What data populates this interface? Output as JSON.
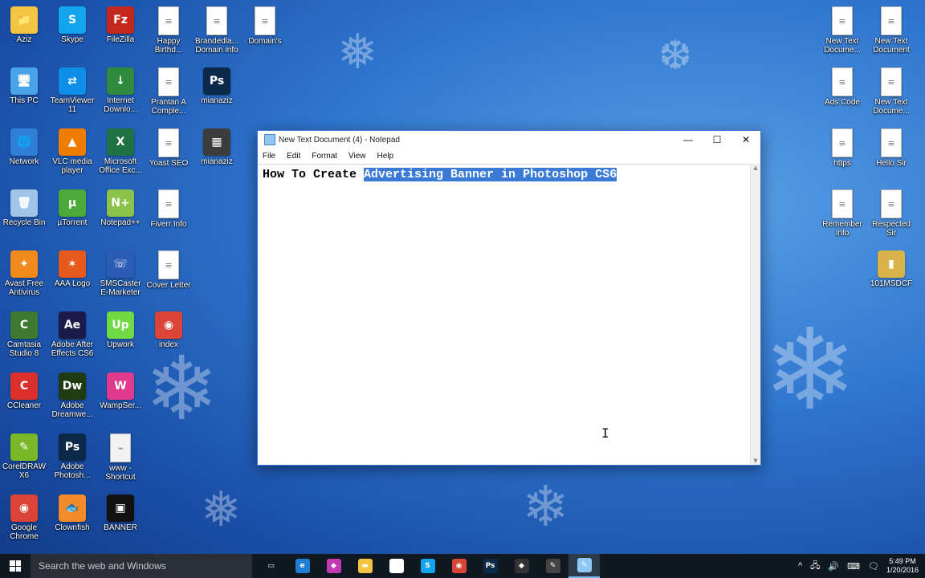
{
  "desktop": {
    "icons": [
      {
        "label": "Aziz",
        "icon": "folder-user-icon",
        "color": "#f4c542",
        "glyph": "📁"
      },
      {
        "label": "Skype",
        "icon": "skype-icon",
        "color": "#12a5ee",
        "glyph": "S"
      },
      {
        "label": "FileZilla",
        "icon": "filezilla-icon",
        "color": "#c4271b",
        "glyph": "Fz"
      },
      {
        "label": "Happy\nBirthd...",
        "icon": "text-document-icon",
        "color": "#ffffff",
        "glyph": "≡"
      },
      {
        "label": "Brandedla...\nDomain info",
        "icon": "text-document-icon",
        "color": "#ffffff",
        "glyph": "≡"
      },
      {
        "label": "Domain's",
        "icon": "text-document-icon",
        "color": "#ffffff",
        "glyph": "≡"
      },
      {
        "label": "This PC",
        "icon": "computer-icon",
        "color": "#4aa3e8",
        "glyph": "🖥"
      },
      {
        "label": "TeamViewer\n11",
        "icon": "teamviewer-icon",
        "color": "#0e8ee9",
        "glyph": "⇄"
      },
      {
        "label": "Internet\nDownlo...",
        "icon": "internet-download-manager-icon",
        "color": "#2e8b3e",
        "glyph": "↓"
      },
      {
        "label": "Prantan A\nComple...",
        "icon": "wordpad-document-icon",
        "color": "#ffffff",
        "glyph": "≡"
      },
      {
        "label": "mianaziz",
        "icon": "photoshop-file-icon",
        "color": "#0b2a4a",
        "glyph": "Ps"
      },
      {
        "label": "Network",
        "icon": "network-icon",
        "color": "#2f7fd6",
        "glyph": "🌐"
      },
      {
        "label": "VLC media\nplayer",
        "icon": "vlc-icon",
        "color": "#f07c00",
        "glyph": "▲"
      },
      {
        "label": "Microsoft\nOffice Exc...",
        "icon": "excel-icon",
        "color": "#1f7244",
        "glyph": "X"
      },
      {
        "label": "Yoast SEO",
        "icon": "wordpad-document-icon",
        "color": "#ffffff",
        "glyph": "≡"
      },
      {
        "label": "mianaziz",
        "icon": "image-file-icon",
        "color": "#3c3c3c",
        "glyph": "▦"
      },
      {
        "label": "Recycle Bin",
        "icon": "recycle-bin-icon",
        "color": "#9fc6e8",
        "glyph": "🗑"
      },
      {
        "label": "µTorrent",
        "icon": "utorrent-icon",
        "color": "#4caa3a",
        "glyph": "µ"
      },
      {
        "label": "Notepad++",
        "icon": "notepadplusplus-icon",
        "color": "#8bc34a",
        "glyph": "N+"
      },
      {
        "label": "Fiverr Info",
        "icon": "wordpad-document-icon",
        "color": "#ffffff",
        "glyph": "≡"
      },
      {
        "label": "Avast Free\nAntivirus",
        "icon": "avast-icon",
        "color": "#f08a1c",
        "glyph": "✦"
      },
      {
        "label": "AAA Logo",
        "icon": "aaa-logo-icon",
        "color": "#e55a1c",
        "glyph": "✶"
      },
      {
        "label": "SMSCaster\nE-Marketer",
        "icon": "phone-icon",
        "color": "#2a5bb5",
        "glyph": "☏"
      },
      {
        "label": "Cover Letter",
        "icon": "wordpad-document-icon",
        "color": "#ffffff",
        "glyph": "≡"
      },
      {
        "label": "Camtasia\nStudio 8",
        "icon": "camtasia-icon",
        "color": "#3d7a2f",
        "glyph": "C"
      },
      {
        "label": "Adobe After\nEffects CS6",
        "icon": "after-effects-icon",
        "color": "#1b1a4a",
        "glyph": "Ae"
      },
      {
        "label": "Upwork",
        "icon": "upwork-icon",
        "color": "#6fda44",
        "glyph": "Up"
      },
      {
        "label": "index",
        "icon": "chrome-html-icon",
        "color": "#db4437",
        "glyph": "◉"
      },
      {
        "label": "CCleaner",
        "icon": "ccleaner-icon",
        "color": "#d9302b",
        "glyph": "C"
      },
      {
        "label": "Adobe\nDreamwe...",
        "icon": "dreamweaver-icon",
        "color": "#1e3b12",
        "glyph": "Dw"
      },
      {
        "label": "WampSer...",
        "icon": "wampserver-icon",
        "color": "#e0398e",
        "glyph": "W"
      },
      {
        "label": "CorelDRAW\nX6",
        "icon": "coreldraw-icon",
        "color": "#79b829",
        "glyph": "✎"
      },
      {
        "label": "Adobe\nPhotosh...",
        "icon": "photoshop-icon",
        "color": "#0b2a4a",
        "glyph": "Ps"
      },
      {
        "label": "www -\nShortcut",
        "icon": "shortcut-file-icon",
        "color": "#f2f2f2",
        "glyph": "⌁"
      },
      {
        "label": "Google\nChrome",
        "icon": "chrome-icon",
        "color": "#db4437",
        "glyph": "◉"
      },
      {
        "label": "Clownfish",
        "icon": "clownfish-icon",
        "color": "#f28c28",
        "glyph": "🐟"
      },
      {
        "label": "BANNER",
        "icon": "image-file-icon",
        "color": "#111111",
        "glyph": "▣"
      },
      {
        "label": "New Text\nDocume...",
        "icon": "text-document-icon",
        "color": "#ffffff",
        "glyph": "≡"
      },
      {
        "label": "New Text\nDocument",
        "icon": "text-document-icon",
        "color": "#ffffff",
        "glyph": "≡"
      },
      {
        "label": "Ads Code",
        "icon": "text-document-icon",
        "color": "#ffffff",
        "glyph": "≡"
      },
      {
        "label": "New Text\nDocume...",
        "icon": "text-document-icon",
        "color": "#ffffff",
        "glyph": "≡"
      },
      {
        "label": "https",
        "icon": "wordpad-document-icon",
        "color": "#ffffff",
        "glyph": "≡"
      },
      {
        "label": "Hello Sir",
        "icon": "wordpad-document-icon",
        "color": "#ffffff",
        "glyph": "≡"
      },
      {
        "label": "Remember\nInfo",
        "icon": "text-document-icon",
        "color": "#ffffff",
        "glyph": "≡"
      },
      {
        "label": "Respected\nSir",
        "icon": "wordpad-document-icon",
        "color": "#ffffff",
        "glyph": "≡"
      },
      {
        "label": "101MSDCF",
        "icon": "folder-icon",
        "color": "#d9b24a",
        "glyph": "▮"
      }
    ]
  },
  "notepad": {
    "title": "New Text Document (4) - Notepad",
    "menu": [
      "File",
      "Edit",
      "Format",
      "View",
      "Help"
    ],
    "text_before": "How To Create ",
    "text_selected": "Advertising Banner in Photoshop CS6",
    "controls": {
      "minimize": "—",
      "maximize": "☐",
      "close": "✕"
    },
    "accent": "#3b7bd6"
  },
  "taskbar": {
    "search_placeholder": "Search the web and Windows",
    "apps": [
      {
        "name": "task-view",
        "glyph": "▭",
        "color": "#101822"
      },
      {
        "name": "edge",
        "glyph": "e",
        "color": "#1f7fd6"
      },
      {
        "name": "onenote-purple",
        "glyph": "◆",
        "color": "#c239b3"
      },
      {
        "name": "file-explorer",
        "glyph": "▬",
        "color": "#f4c542"
      },
      {
        "name": "store",
        "glyph": "🛍",
        "color": "#ffffff"
      },
      {
        "name": "skype",
        "glyph": "S",
        "color": "#12a5ee"
      },
      {
        "name": "chrome",
        "glyph": "◉",
        "color": "#db4437"
      },
      {
        "name": "photoshop",
        "glyph": "Ps",
        "color": "#0b2a4a"
      },
      {
        "name": "app-diamond",
        "glyph": "◆",
        "color": "#333333"
      },
      {
        "name": "app-pen",
        "glyph": "✎",
        "color": "#444444"
      },
      {
        "name": "notepad",
        "glyph": "✎",
        "color": "#8ec7f3"
      }
    ],
    "clock_time": "5:49 PM",
    "clock_date": "1/20/2016",
    "tray": [
      "^",
      "🖧",
      "🔊",
      "⌨",
      "🗨"
    ]
  }
}
